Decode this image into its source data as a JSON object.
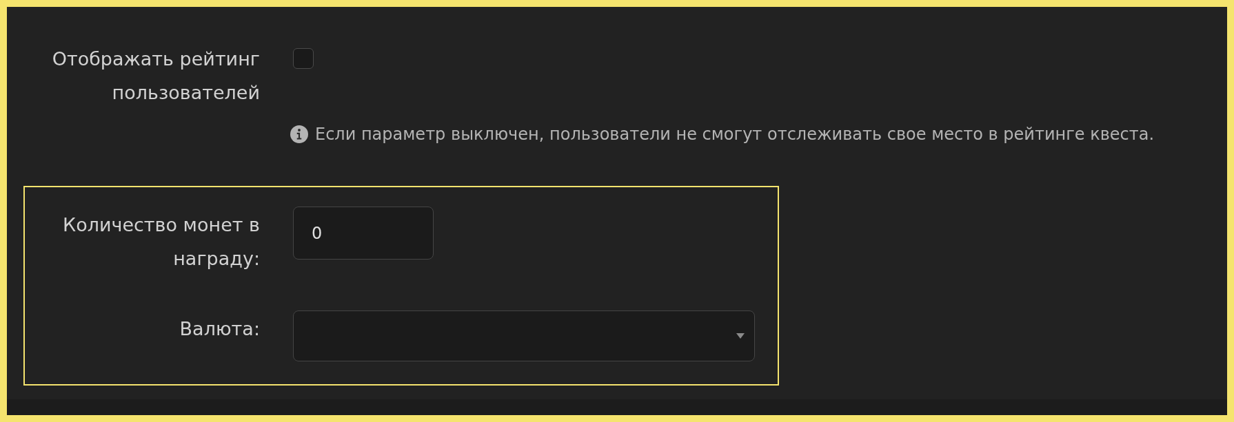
{
  "settings": [
    {
      "kind": "checkbox",
      "label": "Отображать рейтинг пользователей",
      "checked": false,
      "hint": "Если параметр выключен, пользователи не смогут отслеживать свое место в рейтинге квеста."
    }
  ],
  "highlighted": [
    {
      "kind": "number",
      "label": "Количество монет в награду:",
      "value": "0"
    },
    {
      "kind": "select",
      "label": "Валюта:"
    }
  ]
}
